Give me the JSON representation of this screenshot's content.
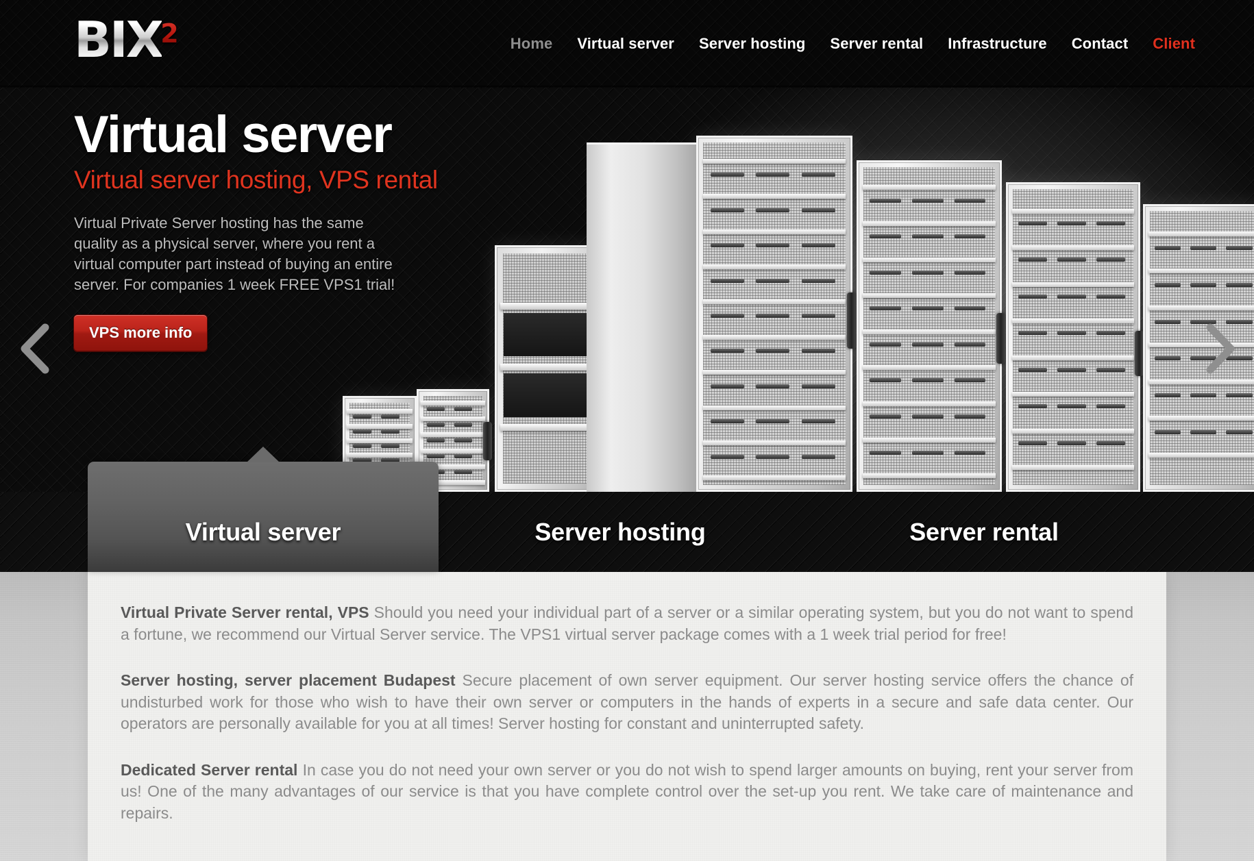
{
  "brand": {
    "name": "BIX",
    "superscript": "2"
  },
  "nav": {
    "items": [
      {
        "label": "Home",
        "style": "muted"
      },
      {
        "label": "Virtual server",
        "style": "normal"
      },
      {
        "label": "Server hosting",
        "style": "normal"
      },
      {
        "label": "Server rental",
        "style": "normal"
      },
      {
        "label": "Infrastructure",
        "style": "normal"
      },
      {
        "label": "Contact",
        "style": "normal"
      },
      {
        "label": "Client",
        "style": "accent"
      }
    ]
  },
  "hero": {
    "title": "Virtual server",
    "subtitle": "Virtual server hosting, VPS rental",
    "body": "Virtual Private Server hosting has the same quality as a physical server, where you rent a virtual computer part instead of buying an entire server. For companies 1 week FREE VPS1 trial!",
    "button_label": "VPS more info",
    "prev_label": "Previous slide",
    "next_label": "Next slide"
  },
  "tabs": [
    {
      "label": "Virtual server",
      "active": true
    },
    {
      "label": "Server hosting",
      "active": false
    },
    {
      "label": "Server rental",
      "active": false
    }
  ],
  "content": {
    "paragraphs": [
      {
        "lead": "Virtual Private Server rental, VPS",
        "text": " Should you need your individual part of a server or a similar operating system, but you do not want to spend a fortune, we recommend our Virtual Server service. The VPS1 virtual server package comes with a 1 week trial period for free!"
      },
      {
        "lead": "Server hosting, server placement Budapest",
        "text": " Secure placement of own server equipment. Our server hosting service offers the chance of undisturbed work for those who wish to have their own server or computers in the hands of experts in a secure and safe data center. Our operators are personally available for you at all times! Server hosting for constant and uninterrupted safety."
      },
      {
        "lead": "Dedicated Server rental",
        "text": " In case you do not need your own server or you do not wish to spend larger amounts on buying, rent your server from us! One of the many advantages of our service is that you have complete control over the set-up you rent. We take care of maintenance and repairs."
      }
    ]
  },
  "colors": {
    "accent_red": "#e0301e",
    "button_red": "#bb241b",
    "header_black": "#070707",
    "content_bg": "#f0f0ee",
    "muted_text": "#8b8b8b"
  }
}
